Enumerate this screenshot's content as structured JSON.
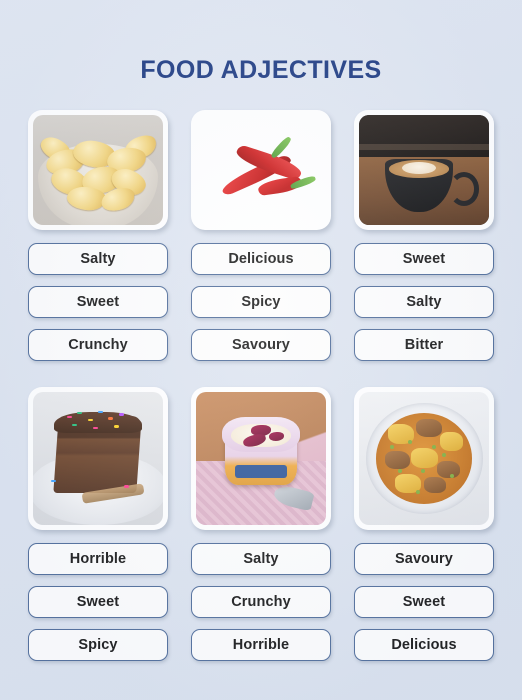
{
  "page": {
    "title": "FOOD ADJECTIVES",
    "background_color": "#dde4f0",
    "title_color": "#17357e",
    "button_border_color": "#4a6897"
  },
  "rows": [
    {
      "items": [
        {
          "image_name": "bowl-of-potato-chips",
          "image_alt": "Bowl of potato crisps",
          "options": [
            "Salty",
            "Sweet",
            "Crunchy"
          ]
        },
        {
          "image_name": "red-chilli-peppers",
          "image_alt": "Two red chilli peppers",
          "options": [
            "Delicious",
            "Spicy",
            "Savoury"
          ]
        },
        {
          "image_name": "cappuccino-cup",
          "image_alt": "Black cup of cappuccino with latte art",
          "options": [
            "Sweet",
            "Salty",
            "Bitter"
          ]
        }
      ]
    },
    {
      "items": [
        {
          "image_name": "chocolate-cake-slice",
          "image_alt": "Slice of chocolate cake with sprinkles",
          "options": [
            "Horrible",
            "Sweet",
            "Spicy"
          ]
        },
        {
          "image_name": "fruit-yogurt-cup",
          "image_alt": "Yogurt cup with berries",
          "options": [
            "Salty",
            "Crunchy",
            "Horrible"
          ]
        },
        {
          "image_name": "meat-potato-stew",
          "image_alt": "Meat and potato stew with peas",
          "options": [
            "Savoury",
            "Sweet",
            "Delicious"
          ]
        }
      ]
    }
  ]
}
